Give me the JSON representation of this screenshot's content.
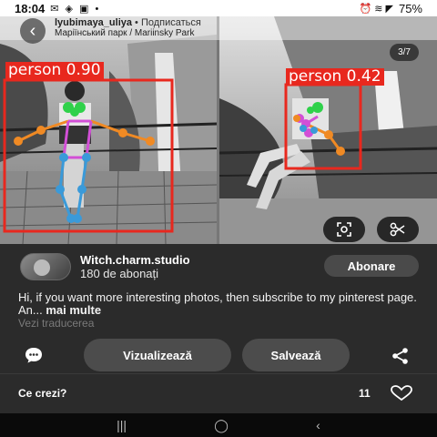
{
  "status": {
    "time": "18:04",
    "battery": "75%",
    "left_icons": "✉ ◈ ▣ •",
    "right_icons": "⏰ ≋ ◤"
  },
  "pin_header": {
    "username": "lyubimaya_uliya",
    "separator": " • ",
    "follow": "Подписаться",
    "location": "Маріїнський парк / Mariinsky Park"
  },
  "media": {
    "counter": "3/7",
    "detections": [
      {
        "label": "person 0.90"
      },
      {
        "label": "person 0.42"
      }
    ]
  },
  "creator": {
    "name": "Witch.charm.studio",
    "subscribers": "180 de abonați",
    "follow_label": "Abonare"
  },
  "description": {
    "text": "Hi, if you want more interesting photos, then subscribe to my pinterest page. An...",
    "more": " mai multe",
    "translate": "Vezi traducerea"
  },
  "actions": {
    "view_label": "Vizualizează",
    "save_label": "Salvează"
  },
  "comments": {
    "prompt": "Ce crezi?",
    "count": "11"
  },
  "icons": {
    "back": "back-arrow-icon",
    "lens": "lens-icon",
    "cut": "scissors-icon",
    "comment": "comment-icon",
    "share": "share-icon",
    "heart": "heart-icon"
  },
  "colors": {
    "detection_box": "#e8281e",
    "background": "#2b2b2b",
    "button": "#4c4c4c"
  }
}
